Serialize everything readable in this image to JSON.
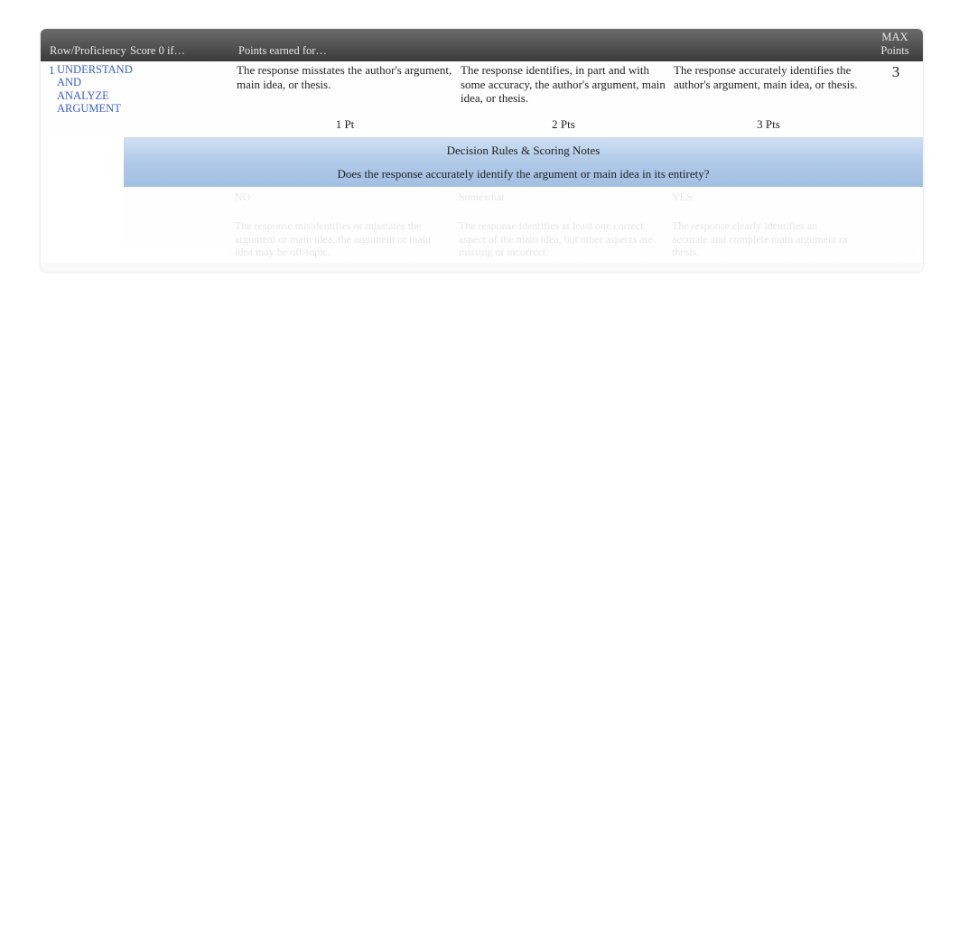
{
  "header": {
    "row_proficiency": "Row/Proficiency",
    "score0": "Score 0 if…",
    "points_earned": "Points earned for…",
    "max_points_top": "MAX",
    "max_points_bottom": "Points"
  },
  "row": {
    "number": "1",
    "proficiency": "UNDERSTAND AND ANALYZE ARGUMENT",
    "max": "3",
    "cells": [
      {
        "desc": "The response misstates the author's argument, main idea, or thesis.",
        "pts": "1 Pt"
      },
      {
        "desc": "The response identifies, in part and with some accuracy, the author's argument, main idea, or thesis.",
        "pts": "2 Pts"
      },
      {
        "desc": "The response accurately identifies the author's argument, main idea, or thesis.",
        "pts": "3 Pts"
      }
    ]
  },
  "decision": {
    "title": "Decision Rules & Scoring Notes",
    "question": "Does the response accurately identify the argument or main idea in its entirety?"
  },
  "faded": {
    "answers": [
      "NO",
      "Somewhat",
      "YES"
    ],
    "texts": [
      "The response misidentifies or misstates the argument or main idea; the argument or main idea may be off-topic.",
      "The response identifies at least one correct aspect of the main idea, but other aspects are missing or incorrect.",
      "The response clearly identifies an accurate and complete main argument or thesis."
    ]
  }
}
